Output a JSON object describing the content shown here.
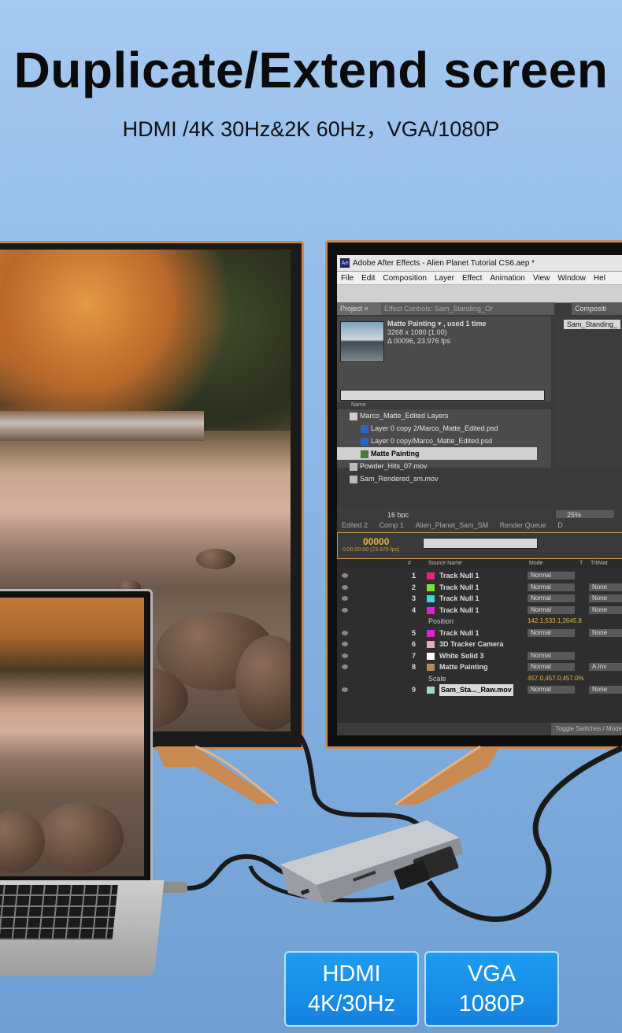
{
  "headline": "Duplicate/Extend screen",
  "subheadline": "HDMI /4K 30Hz&2K 60Hz，VGA/1080P",
  "after_effects": {
    "window_title": "Adobe After Effects - Alien Planet Tutorial CS6.aep *",
    "logo": "Ae",
    "menu": [
      "File",
      "Edit",
      "Composition",
      "Layer",
      "Effect",
      "Animation",
      "View",
      "Window",
      "Hel"
    ],
    "project_tab": "Project ×",
    "effect_controls_tab": "Effect Controls: Sam_Standing_Or",
    "comp_tab": "Compositi",
    "comp_name": "Sam_Standing_",
    "selected_item": {
      "name": "Matte Painting ▾ , used 1 time",
      "dims": "3268 x 1080 (1.00)",
      "duration": "Δ 00096, 23.976 fps"
    },
    "name_column": "Name",
    "project_items": [
      {
        "label": "Marco_Matte_Edited Layers",
        "indent": 0
      },
      {
        "label": "Layer 0 copy 2/Marco_Matte_Edited.psd",
        "indent": 1
      },
      {
        "label": "Layer 0 copy/Marco_Matte_Edited.psd",
        "indent": 1
      },
      {
        "label": "Matte Painting",
        "indent": 1
      },
      {
        "label": "Powder_Hits_07.mov",
        "indent": 0
      },
      {
        "label": "Sam_Rendered_sm.mov",
        "indent": 0
      }
    ],
    "bpc": "16 bpc",
    "zoom": "25%",
    "timeline_tabs": [
      "Edited 2",
      "Comp 1",
      "Alien_Planet_Sam_SM",
      "Render Queue",
      "D"
    ],
    "timecode": "00000",
    "timecode_sub": "0:00:00:00 (23.976 fps)",
    "columns": {
      "num": "#",
      "source": "Source Name",
      "mode": "Mode",
      "t": "T",
      "trkmat": "TrkMat"
    },
    "layers": [
      {
        "num": "1",
        "name": "Track Null 1",
        "color": "#e8207a",
        "mode": "Normal",
        "trkmat": ""
      },
      {
        "num": "2",
        "name": "Track Null 1",
        "color": "#7be033",
        "mode": "Normal",
        "trkmat": "None"
      },
      {
        "num": "3",
        "name": "Track Null 1",
        "color": "#39d6e6",
        "mode": "Normal",
        "trkmat": "None"
      },
      {
        "num": "4",
        "name": "Track Null 1",
        "color": "#e620d2",
        "mode": "Normal",
        "trkmat": "None"
      },
      {
        "sub": true,
        "name": "Position",
        "value": "142.1,533.1,2645.8"
      },
      {
        "num": "5",
        "name": "Track Null 1",
        "color": "#e620d2",
        "mode": "Normal",
        "trkmat": "None"
      },
      {
        "num": "6",
        "name": "3D Tracker Camera",
        "color": "#e6aab6",
        "mode": "",
        "trkmat": ""
      },
      {
        "num": "7",
        "name": "White Solid 3",
        "color": "#ffffff",
        "mode": "Normal",
        "trkmat": ""
      },
      {
        "num": "8",
        "name": "Matte Painting",
        "color": "#b58a5a",
        "mode": "Normal",
        "trkmat": "A.Inv"
      },
      {
        "sub": true,
        "name": "Scale",
        "value": "457.0,457.0,457.0%"
      },
      {
        "num": "9",
        "name": "Sam_Sta..._Raw.mov",
        "color": "#9ed6c8",
        "mode": "Normal",
        "trkmat": "None",
        "selected": true
      }
    ],
    "footer": "Toggle Switches / Modes"
  },
  "badges": [
    {
      "line1": "HDMI",
      "line2": "4K/30Hz"
    },
    {
      "line1": "VGA",
      "line2": "1080P"
    }
  ],
  "colors": {
    "accent_badge": "#1d9cf1",
    "monitor_frame": "#c98a52",
    "timecode": "#e3b34a"
  }
}
